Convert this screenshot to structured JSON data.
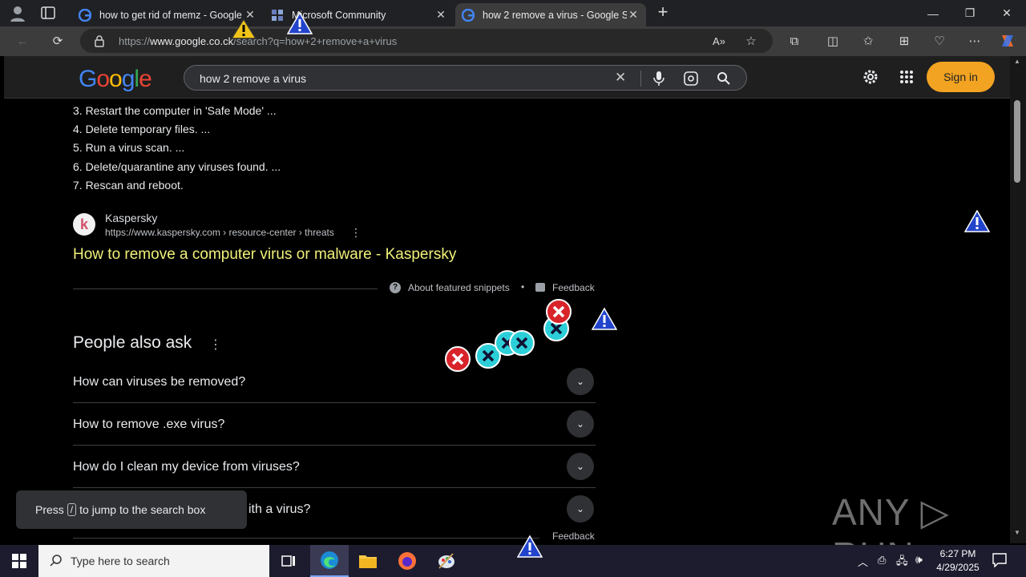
{
  "tabs": [
    {
      "title": "how to get rid of memz - Google",
      "active": false
    },
    {
      "title": "Microsoft Community",
      "active": false
    },
    {
      "title": "how 2 remove a virus - Google S",
      "active": true
    }
  ],
  "address": {
    "prefix": "https://",
    "domain": "www.google.co.ck",
    "path": "/search?q=how+2+remove+a+virus"
  },
  "google": {
    "logo_letters": [
      "G",
      "o",
      "o",
      "g",
      "l",
      "e"
    ],
    "logo_colors": [
      "#4285f4",
      "#ea4335",
      "#fbbc05",
      "#4285f4",
      "#34a853",
      "#ea4335"
    ],
    "query": "how 2 remove a virus",
    "signin_label": "Sign in"
  },
  "steps": [
    "3. Restart the computer in 'Safe Mode' ...",
    "4. Delete temporary files. ...",
    "5. Run a virus scan. ...",
    "6. Delete/quarantine any viruses found. ...",
    "7. Rescan and reboot."
  ],
  "result": {
    "favicon_letter": "k",
    "source": "Kaspersky",
    "url": "https://www.kaspersky.com › resource-center › threats",
    "title": "How to remove a computer virus or malware - Kaspersky"
  },
  "snippet_footer": {
    "about": "About featured snippets",
    "feedback": "Feedback"
  },
  "paa": {
    "heading": "People also ask",
    "questions": [
      "How can viruses be removed?",
      "How to remove .exe virus?",
      "How do I clean my device from viruses?",
      "ith a virus?"
    ],
    "feedback": "Feedback"
  },
  "toast": {
    "before": "Press",
    "key": "/",
    "after": "to jump to the search box"
  },
  "taskbar": {
    "search_placeholder": "Type here to search",
    "time": "6:27 PM",
    "date": "4/29/2025"
  },
  "watermark": "ANY ▷ RUN"
}
